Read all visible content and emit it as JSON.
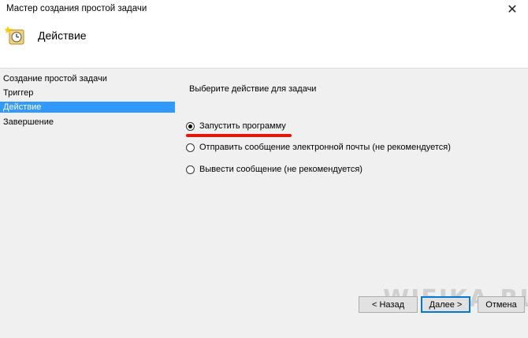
{
  "window": {
    "title": "Мастер создания простой задачи",
    "close_glyph": "✕"
  },
  "header": {
    "title": "Действие",
    "icon": "task-scheduler-icon"
  },
  "sidebar": {
    "items": [
      {
        "label": "Создание простой задачи",
        "active": false
      },
      {
        "label": "Триггер",
        "active": false
      },
      {
        "label": "Действие",
        "active": true
      },
      {
        "label": "Завершение",
        "active": false
      }
    ]
  },
  "main": {
    "prompt": "Выберите действие для задачи",
    "options": [
      {
        "label": "Запустить программу",
        "checked": true
      },
      {
        "label": "Отправить сообщение электронной почты (не рекомендуется)",
        "checked": false
      },
      {
        "label": "Вывести сообщение (не рекомендуется)",
        "checked": false
      }
    ]
  },
  "buttons": {
    "back": "< Назад",
    "next": "Далее >",
    "cancel": "Отмена"
  },
  "watermark": "WIFIKA.RU",
  "colors": {
    "selection": "#3399ff",
    "annotation_underline": "#e4160c",
    "primary_border": "#0078d7"
  }
}
